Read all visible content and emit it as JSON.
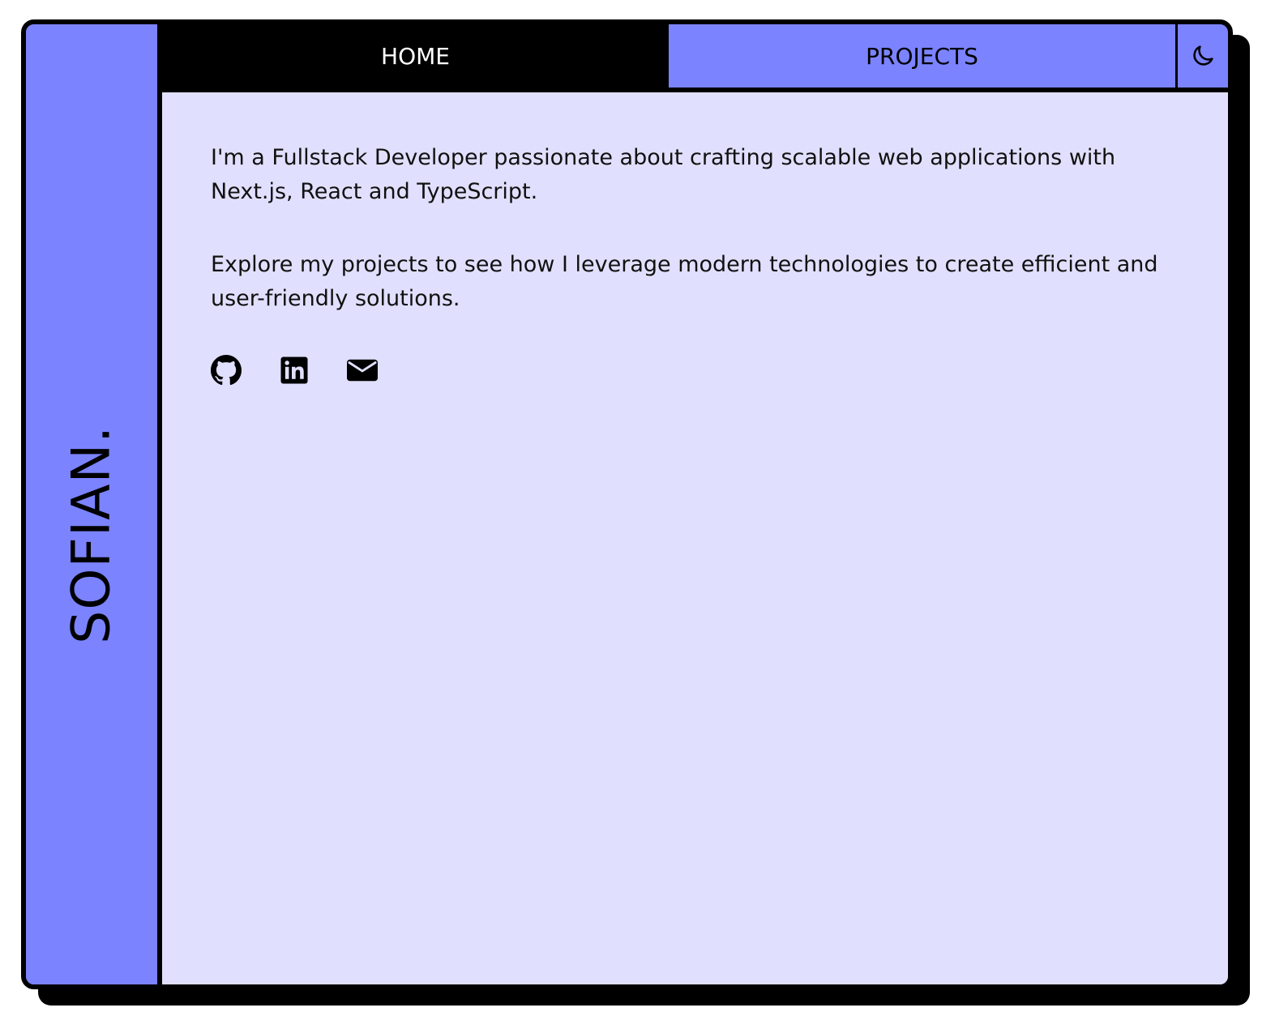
{
  "brand": {
    "name": "SOFIAN."
  },
  "nav": {
    "tabs": [
      {
        "label": "HOME",
        "active": true
      },
      {
        "label": "PROJECTS",
        "active": false
      }
    ],
    "theme_toggle_icon": "moon-icon"
  },
  "content": {
    "paragraphs": [
      "I'm a Fullstack Developer passionate about crafting scalable web applications with Next.js, React and TypeScript.",
      "Explore my projects to see how I leverage modern technologies to create efficient and user-friendly solutions."
    ]
  },
  "socials": [
    {
      "icon": "github-icon"
    },
    {
      "icon": "linkedin-icon"
    },
    {
      "icon": "mail-icon"
    }
  ],
  "colors": {
    "accent": "#7b83ff",
    "content_bg": "#e0e0fe",
    "border": "#000000",
    "active_tab_text": "#ffffff"
  }
}
